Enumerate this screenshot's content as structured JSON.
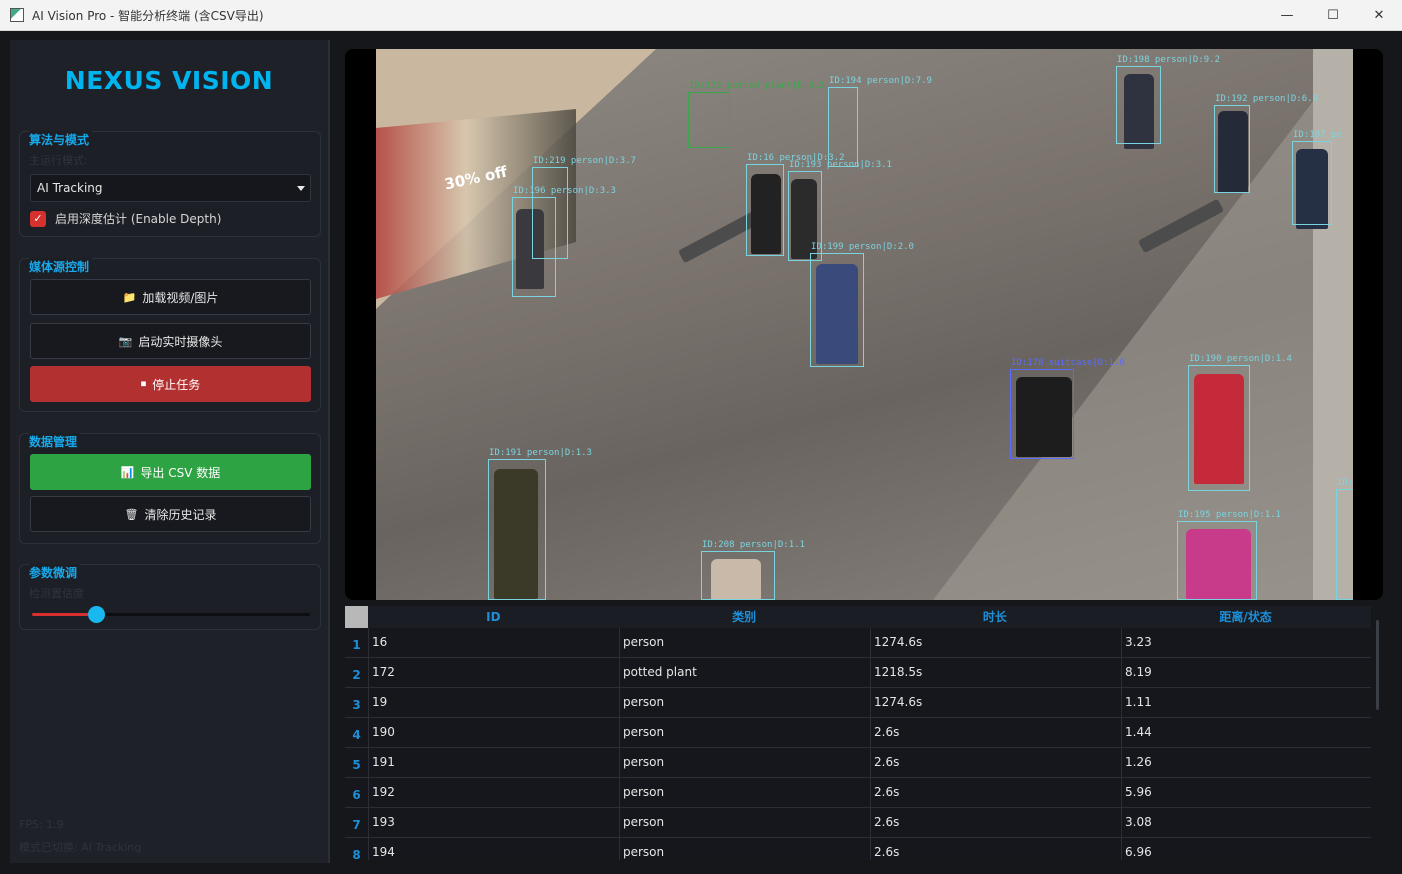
{
  "window": {
    "title": "AI Vision Pro - 智能分析终端 (含CSV导出)",
    "minimize_label": "—",
    "maximize_label": "☐",
    "close_label": "✕"
  },
  "sidebar": {
    "brand": "NEXUS VISION",
    "algo_group": {
      "title": "算法与模式",
      "subtitle": "主运行模式:",
      "mode_select_value": "AI Tracking",
      "depth_checkbox_label": "启用深度估计 (Enable Depth)",
      "depth_checked": true
    },
    "media_group": {
      "title": "媒体源控制",
      "load_button": "加载视频/图片",
      "load_icon": "📁",
      "camera_button": "启动实时摄像头",
      "camera_icon": "📷",
      "stop_button": "停止任务",
      "stop_icon": "⏹"
    },
    "data_group": {
      "title": "数据管理",
      "export_button": "导出 CSV 数据",
      "export_icon": "📊",
      "clear_button": "清除历史记录",
      "clear_icon": "🗑"
    },
    "params_group": {
      "title": "参数微调",
      "subtitle": "检测置信度",
      "confidence_fraction": 0.23
    },
    "fps_text": "FPS: 1.9",
    "mode_status_text": "模式已切换: AI Tracking"
  },
  "video": {
    "detections": [
      {
        "label": "ID:172 potted plant|D:8.2",
        "color": "#3aa84a"
      },
      {
        "label": "ID:194 person|D:7.9",
        "color": "#7ad4e0"
      },
      {
        "label": "ID:198 person|D:9.2",
        "color": "#7ad4e0"
      },
      {
        "label": "ID:192 person|D:6.0",
        "color": "#7ad4e0"
      },
      {
        "label": "ID:197 pe",
        "color": "#7ad4e0"
      },
      {
        "label": "ID:219 person|D:3.7",
        "color": "#7ad4e0"
      },
      {
        "label": "ID:196 person|D:3.3",
        "color": "#7ad4e0"
      },
      {
        "label": "ID:16 person|D:3.2",
        "color": "#7ad4e0"
      },
      {
        "label": "ID:193 person|D:3.1",
        "color": "#7ad4e0"
      },
      {
        "label": "ID:199 person|D:2.0",
        "color": "#7ad4e0"
      },
      {
        "label": "ID:178 suitcase|D:1.6",
        "color": "#5a6cff"
      },
      {
        "label": "ID:190 person|D:1.4",
        "color": "#7ad4e0"
      },
      {
        "label": "ID:191 person|D:1.3",
        "color": "#7ad4e0"
      },
      {
        "label": "ID:208 person|D:1.1",
        "color": "#7ad4e0"
      },
      {
        "label": "ID:195 person|D:1.1",
        "color": "#7ad4e0"
      },
      {
        "label": "ID:",
        "color": "#7ad4e0"
      }
    ],
    "shop_sign": "30% off"
  },
  "table": {
    "headers": [
      "ID",
      "类别",
      "时长",
      "距离/状态"
    ],
    "rows": [
      {
        "num": "1",
        "id": "16",
        "cls": "person",
        "dur": "1274.6s",
        "dist": "3.23"
      },
      {
        "num": "2",
        "id": "172",
        "cls": "potted plant",
        "dur": "1218.5s",
        "dist": "8.19"
      },
      {
        "num": "3",
        "id": "19",
        "cls": "person",
        "dur": "1274.6s",
        "dist": "1.11"
      },
      {
        "num": "4",
        "id": "190",
        "cls": "person",
        "dur": "2.6s",
        "dist": "1.44"
      },
      {
        "num": "5",
        "id": "191",
        "cls": "person",
        "dur": "2.6s",
        "dist": "1.26"
      },
      {
        "num": "6",
        "id": "192",
        "cls": "person",
        "dur": "2.6s",
        "dist": "5.96"
      },
      {
        "num": "7",
        "id": "193",
        "cls": "person",
        "dur": "2.6s",
        "dist": "3.08"
      },
      {
        "num": "8",
        "id": "194",
        "cls": "person",
        "dur": "2.6s",
        "dist": "6.96"
      }
    ]
  }
}
